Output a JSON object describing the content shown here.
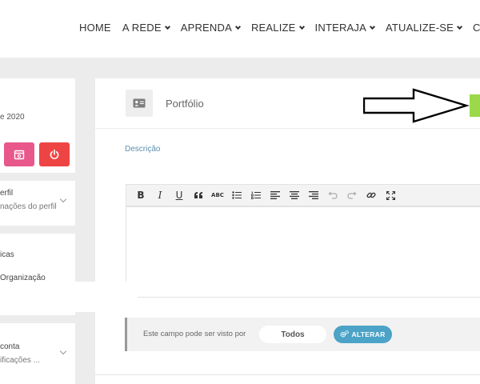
{
  "nav": {
    "items": [
      {
        "label": "HOME",
        "dropdown": false
      },
      {
        "label": "A REDE",
        "dropdown": true
      },
      {
        "label": "APRENDA",
        "dropdown": true
      },
      {
        "label": "REALIZE",
        "dropdown": true
      },
      {
        "label": "INTERAJA",
        "dropdown": true
      },
      {
        "label": "ATUALIZE-SE",
        "dropdown": true
      },
      {
        "label": "C",
        "dropdown": false
      }
    ]
  },
  "sidebar": {
    "date_fragment": "e 2020",
    "buttons": [
      {
        "icon": "calendar-icon",
        "color": "#e8588a"
      },
      {
        "icon": "power-icon",
        "color": "#ef4444"
      }
    ],
    "profile_section": {
      "title": "erfil",
      "subtitle": "nações do perfil"
    },
    "links": [
      "icas",
      "Organização"
    ],
    "account_section": {
      "title": "conta",
      "subtitle": "ificações ..."
    }
  },
  "main": {
    "header": {
      "icon": "id-card-icon",
      "title": "Portfólio",
      "action_color": "#9bd94a"
    },
    "description_label": "Descrição",
    "toolbar": {
      "buttons": [
        "B",
        "I",
        "U",
        "“",
        "ABC",
        "bullet-list",
        "numbered-list",
        "align-left",
        "align-center",
        "align-right",
        "undo",
        "redo",
        "link",
        "fullscreen"
      ]
    },
    "editor": {
      "value": ""
    },
    "visibility": {
      "text": "Este campo pode ser visto por",
      "value": "Todos",
      "change_label": "ALTERAR"
    }
  },
  "colors": {
    "accent_blue": "#4ba3c7",
    "label_blue": "#5b8fb0",
    "green": "#9bd94a",
    "pink": "#e8588a",
    "red": "#ef4444"
  }
}
